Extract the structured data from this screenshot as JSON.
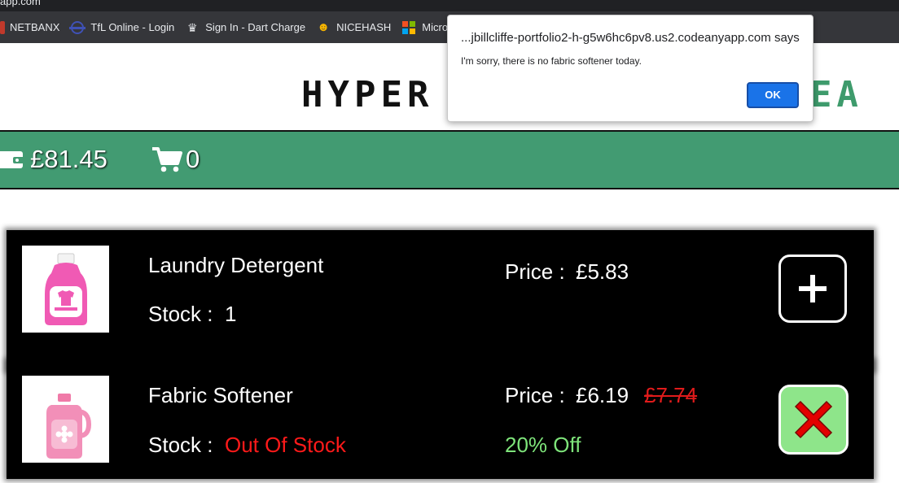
{
  "browser": {
    "url_fragment": "app.com",
    "bookmarks": [
      {
        "label": "NETBANX",
        "icon": "netbanx-icon"
      },
      {
        "label": "TfL Online - Login",
        "icon": "tfl-roundel-icon"
      },
      {
        "label": "Sign In - Dart Charge",
        "icon": "dart-charge-icon"
      },
      {
        "label": "NICEHASH",
        "icon": "nicehash-icon"
      },
      {
        "label": "Microsoft 3",
        "icon": "microsoft-icon"
      }
    ]
  },
  "site": {
    "logo_dark": "HYPER",
    "logo_green": "HEA"
  },
  "balance_bar": {
    "balance": "£81.45",
    "cart_count": "0",
    "color": "#429b72"
  },
  "products": [
    {
      "name": "Laundry Detergent",
      "stock_label": "Stock :",
      "stock_value": "1",
      "price_label": "Price :",
      "price": "£5.83",
      "action": "add",
      "image_icon": "detergent-bottle-icon"
    },
    {
      "name": "Fabric Softener",
      "stock_label": "Stock :",
      "stock_value": "Out Of Stock",
      "price_label": "Price :",
      "price": "£6.19",
      "old_price": "£7.74",
      "discount": "20% Off",
      "action": "unavailable",
      "image_icon": "softener-bottle-icon"
    }
  ],
  "dialog": {
    "title": "...jbillcliffe-portfolio2-h-g5w6hc6pv8.us2.codeanyapp.com says",
    "message": "I'm sorry, there is no fabric softener today.",
    "ok_label": "OK"
  }
}
